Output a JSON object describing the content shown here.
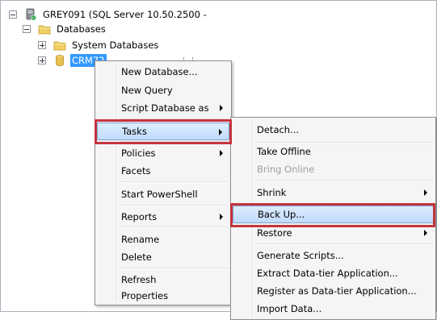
{
  "tree": {
    "server": {
      "label": "GREY091 (SQL Server 10.50.2500 -",
      "icon": "server-icon"
    },
    "databases": {
      "label": "Databases",
      "icon": "folder-icon"
    },
    "system_databases": {
      "label": "System Databases",
      "icon": "folder-icon"
    },
    "crm": {
      "label": "CRM72",
      "icon": "database-icon"
    }
  },
  "context_menu": {
    "new_database": "New Database...",
    "new_query": "New Query",
    "script_database_as": "Script Database as",
    "tasks": "Tasks",
    "policies": "Policies",
    "facets": "Facets",
    "start_powershell": "Start PowerShell",
    "reports": "Reports",
    "rename": "Rename",
    "delete": "Delete",
    "refresh": "Refresh",
    "properties": "Properties"
  },
  "tasks_menu": {
    "detach": "Detach...",
    "take_offline": "Take Offline",
    "bring_online": "Bring Online",
    "shrink": "Shrink",
    "back_up": "Back Up...",
    "restore": "Restore",
    "generate_scripts": "Generate Scripts...",
    "extract_data_tier": "Extract Data-tier Application...",
    "register_data_tier": "Register as Data-tier Application...",
    "import_data": "Import Data..."
  },
  "colors": {
    "callout": "#c4343d",
    "highlight": "#c1dbfc",
    "selection": "#3399ff"
  }
}
